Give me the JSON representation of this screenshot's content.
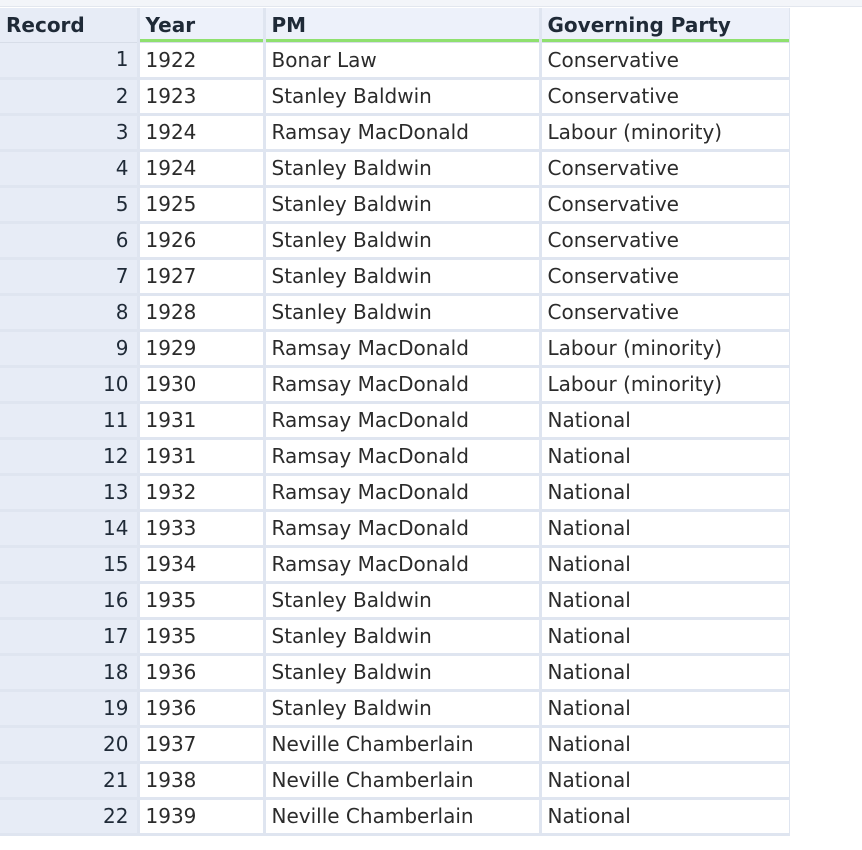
{
  "table": {
    "columns": [
      "Record",
      "Year",
      "PM",
      "Governing Party"
    ],
    "rows": [
      {
        "record": "1",
        "year": "1922",
        "pm": "Bonar Law",
        "party": "Conservative"
      },
      {
        "record": "2",
        "year": "1923",
        "pm": "Stanley Baldwin",
        "party": "Conservative"
      },
      {
        "record": "3",
        "year": "1924",
        "pm": "Ramsay MacDonald",
        "party": "Labour (minority)"
      },
      {
        "record": "4",
        "year": "1924",
        "pm": "Stanley Baldwin",
        "party": "Conservative"
      },
      {
        "record": "5",
        "year": "1925",
        "pm": "Stanley Baldwin",
        "party": "Conservative"
      },
      {
        "record": "6",
        "year": "1926",
        "pm": "Stanley Baldwin",
        "party": "Conservative"
      },
      {
        "record": "7",
        "year": "1927",
        "pm": "Stanley Baldwin",
        "party": "Conservative"
      },
      {
        "record": "8",
        "year": "1928",
        "pm": "Stanley Baldwin",
        "party": "Conservative"
      },
      {
        "record": "9",
        "year": "1929",
        "pm": "Ramsay MacDonald",
        "party": "Labour (minority)"
      },
      {
        "record": "10",
        "year": "1930",
        "pm": "Ramsay MacDonald",
        "party": "Labour (minority)"
      },
      {
        "record": "11",
        "year": "1931",
        "pm": "Ramsay MacDonald",
        "party": "National"
      },
      {
        "record": "12",
        "year": "1931",
        "pm": "Ramsay MacDonald",
        "party": "National"
      },
      {
        "record": "13",
        "year": "1932",
        "pm": "Ramsay MacDonald",
        "party": "National"
      },
      {
        "record": "14",
        "year": "1933",
        "pm": "Ramsay MacDonald",
        "party": "National"
      },
      {
        "record": "15",
        "year": "1934",
        "pm": "Ramsay MacDonald",
        "party": "National"
      },
      {
        "record": "16",
        "year": "1935",
        "pm": "Stanley Baldwin",
        "party": "National"
      },
      {
        "record": "17",
        "year": "1935",
        "pm": "Stanley Baldwin",
        "party": "National"
      },
      {
        "record": "18",
        "year": "1936",
        "pm": "Stanley Baldwin",
        "party": "National"
      },
      {
        "record": "19",
        "year": "1936",
        "pm": "Stanley Baldwin",
        "party": "National"
      },
      {
        "record": "20",
        "year": "1937",
        "pm": "Neville Chamberlain",
        "party": "National"
      },
      {
        "record": "21",
        "year": "1938",
        "pm": "Neville Chamberlain",
        "party": "National"
      },
      {
        "record": "22",
        "year": "1939",
        "pm": "Neville Chamberlain",
        "party": "National"
      }
    ]
  },
  "colors": {
    "header_bg": "#eef1f9",
    "record_bg": "#e7ecf6",
    "grid_line": "#dfe5f0",
    "header_accent": "#8fe06e"
  }
}
